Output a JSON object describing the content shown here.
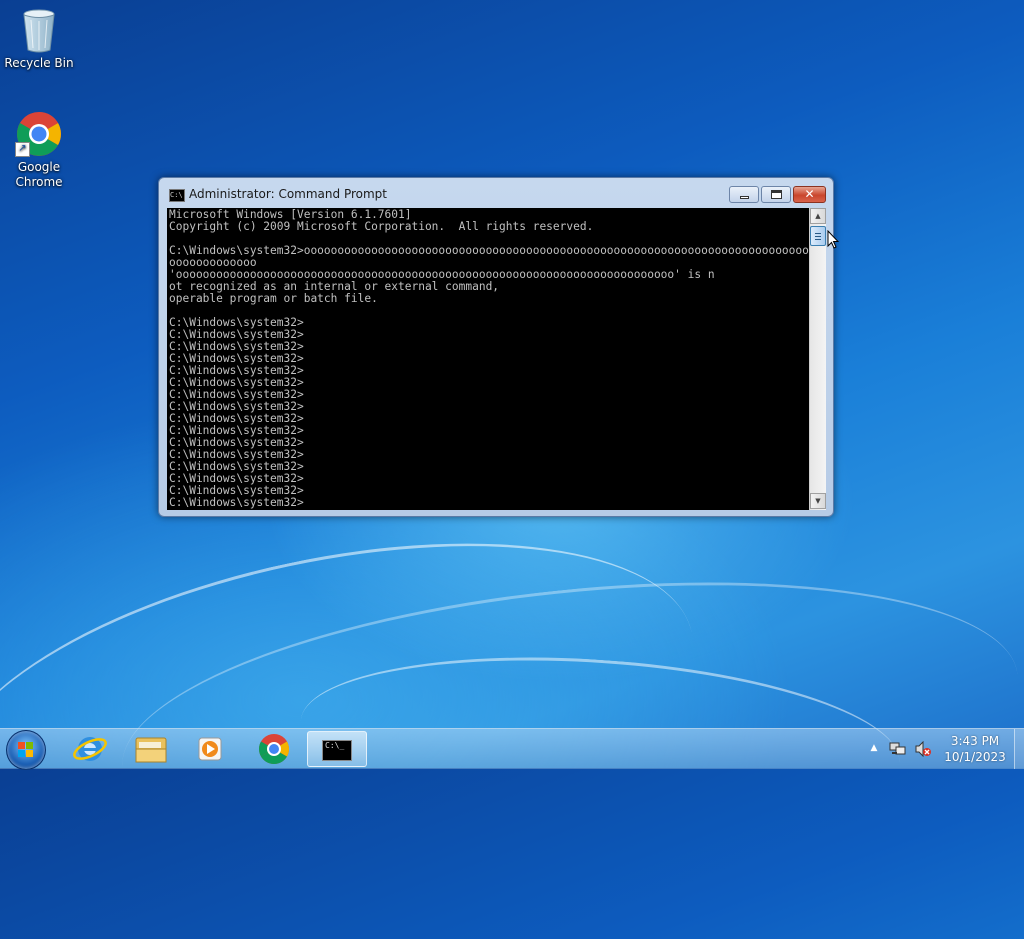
{
  "desktop": {
    "icons": [
      {
        "label": "Recycle Bin"
      },
      {
        "label": "Google\nChrome"
      }
    ]
  },
  "window": {
    "title": "Administrator:  Command Prompt",
    "console_text": "Microsoft Windows [Version 6.1.7601]\nCopyright (c) 2009 Microsoft Corporation.  All rights reserved.\n\nC:\\Windows\\system32>ooooooooooooooooooooooooooooooooooooooooooooooooooooooooooooooooooooooooooooo\nooooooooooooo\n'oooooooooooooooooooooooooooooooooooooooooooooooooooooooooooooooooooooooooo' is n\not recognized as an internal or external command,\noperable program or batch file.\n\nC:\\Windows\\system32>\nC:\\Windows\\system32>\nC:\\Windows\\system32>\nC:\\Windows\\system32>\nC:\\Windows\\system32>\nC:\\Windows\\system32>\nC:\\Windows\\system32>\nC:\\Windows\\system32>\nC:\\Windows\\system32>\nC:\\Windows\\system32>\nC:\\Windows\\system32>\nC:\\Windows\\system32>\nC:\\Windows\\system32>\nC:\\Windows\\system32>\nC:\\Windows\\system32>\nC:\\Windows\\system32>",
    "controls": {
      "minimize": "minimize-icon",
      "maximize": "maximize-icon",
      "close": "close-icon"
    }
  },
  "taskbar": {
    "pinned": [
      "start-orb-icon",
      "internet-explorer-icon",
      "windows-explorer-icon",
      "media-player-icon",
      "chrome-icon",
      "command-prompt-icon"
    ],
    "tray": {
      "time": "3:43 PM",
      "date": "10/1/2023"
    }
  },
  "colors": {
    "console_bg": "#000000",
    "console_fg": "#c0c0c0",
    "close_button": "#c9462d"
  }
}
